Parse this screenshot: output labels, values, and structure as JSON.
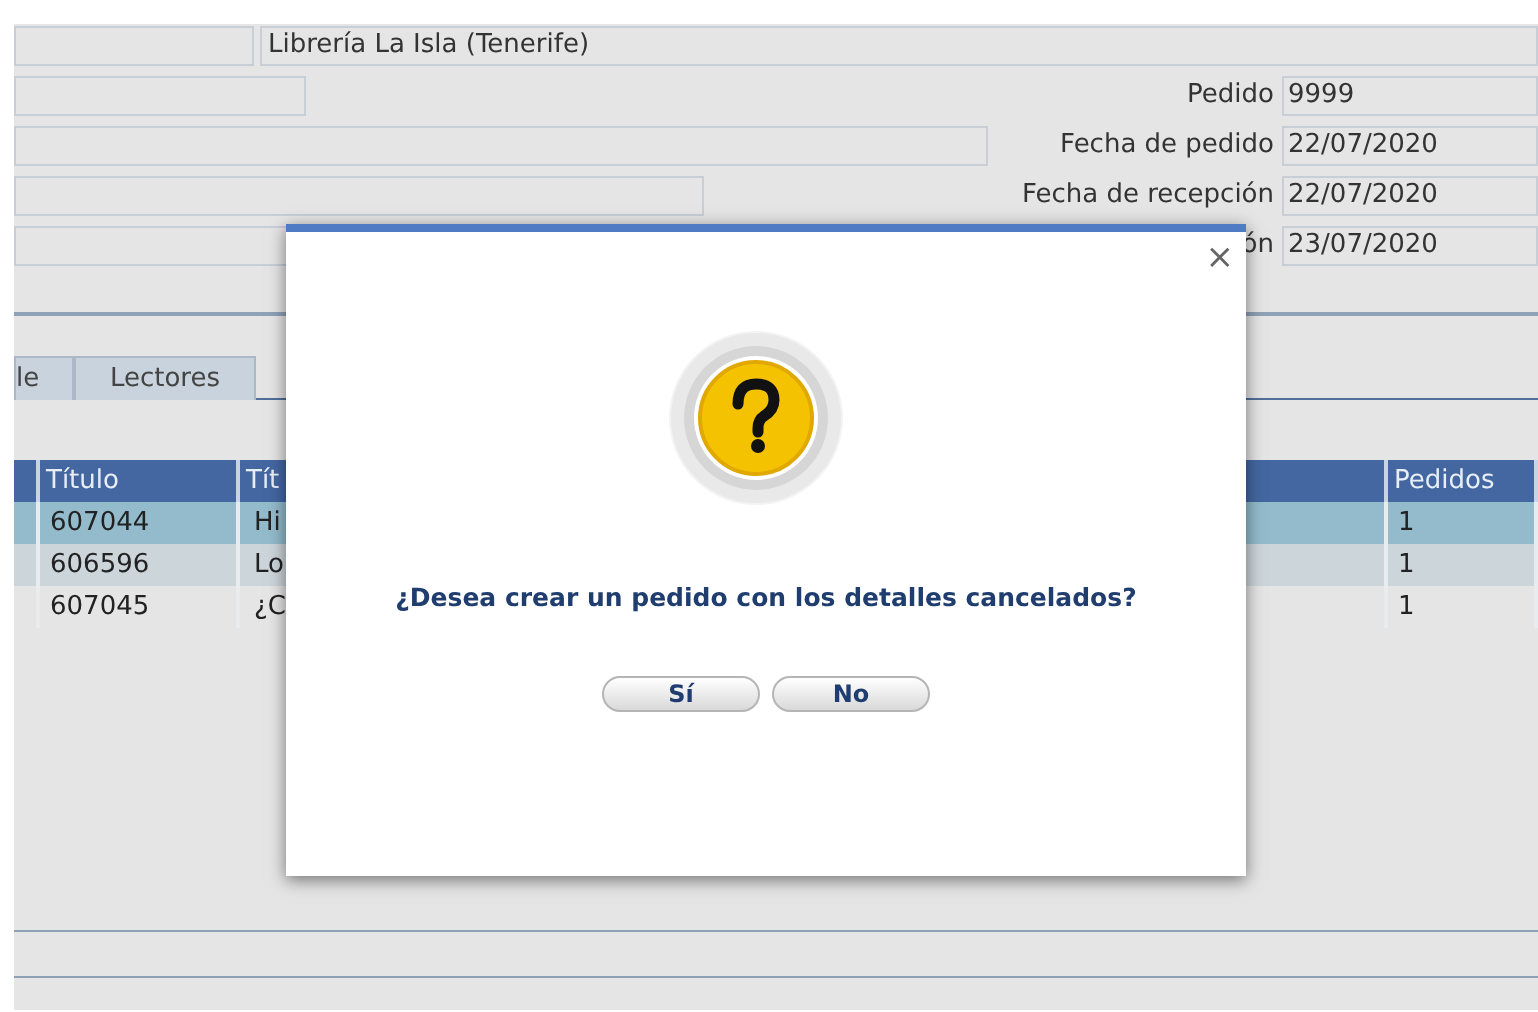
{
  "header": {
    "store": "Librería La Isla (Tenerife)"
  },
  "form_rows": [
    {
      "label": "Pedido",
      "value": "9999"
    },
    {
      "label": "Fecha de pedido",
      "value": "22/07/2020"
    },
    {
      "label": "Fecha de recepción",
      "value": "22/07/2020"
    },
    {
      "label": "ón",
      "value": "23/07/2020"
    }
  ],
  "tabs": [
    {
      "label": "le",
      "selected": false
    },
    {
      "label": "Lectores",
      "selected": false
    }
  ],
  "table": {
    "columns": [
      "Título",
      "Tít",
      "Pedidos"
    ],
    "rows": [
      {
        "cells": [
          "607044",
          "Hi",
          "1"
        ],
        "selected": true
      },
      {
        "cells": [
          "606596",
          "Lo",
          "1"
        ],
        "selected": false
      },
      {
        "cells": [
          "607045",
          "¿C",
          "1"
        ],
        "selected": false
      }
    ]
  },
  "dialog": {
    "message": "¿Desea crear un pedido con los detalles cancelados?",
    "close": "×",
    "buttons": [
      "Sí",
      "No"
    ]
  }
}
